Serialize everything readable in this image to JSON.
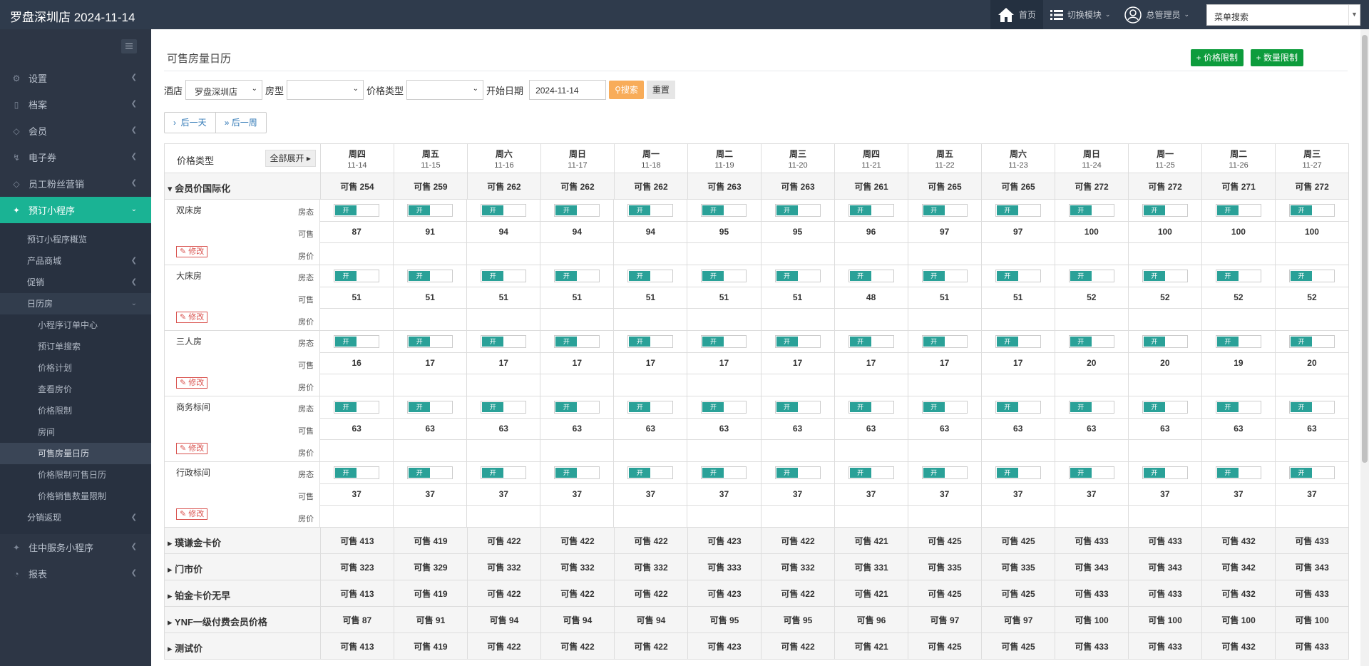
{
  "header": {
    "brand": "罗盘深圳店 2024-11-14",
    "home": "首页",
    "switch_module": "切换模块",
    "admin": "总管理员",
    "menu_search": "菜单搜索"
  },
  "sidebar": {
    "items": [
      {
        "label": "设置"
      },
      {
        "label": "档案"
      },
      {
        "label": "会员"
      },
      {
        "label": "电子券"
      },
      {
        "label": "员工粉丝营销"
      },
      {
        "label": "预订小程序"
      }
    ],
    "sub1": [
      "预订小程序概览",
      "产品商城",
      "促销",
      "日历房"
    ],
    "sub2": [
      "小程序订单中心",
      "预订单搜索",
      "价格计划",
      "查看房价",
      "价格限制",
      "房间",
      "可售房量日历",
      "价格限制可售日历",
      "价格销售数量限制"
    ],
    "sub_after": "分销返现",
    "items_after": [
      {
        "label": "住中服务小程序"
      },
      {
        "label": "报表"
      }
    ]
  },
  "page": {
    "title": "可售房量日历",
    "btn_price_limit": "+ 价格限制",
    "btn_qty_limit": "+ 数量限制"
  },
  "filters": {
    "hotel_label": "酒店",
    "hotel_value": "罗盘深圳店",
    "room_type_label": "房型",
    "price_type_label": "价格类型",
    "start_date_label": "开始日期",
    "start_date_value": "2024-11-14",
    "search": "搜索",
    "reset": "重置"
  },
  "pager": {
    "next_day": "后一天",
    "next_week": "后一周"
  },
  "grid": {
    "price_type_header": "价格类型",
    "expand_all": "全部展开",
    "days": [
      {
        "wd": "周四",
        "dt": "11-14"
      },
      {
        "wd": "周五",
        "dt": "11-15"
      },
      {
        "wd": "周六",
        "dt": "11-16"
      },
      {
        "wd": "周日",
        "dt": "11-17"
      },
      {
        "wd": "周一",
        "dt": "11-18"
      },
      {
        "wd": "周二",
        "dt": "11-19"
      },
      {
        "wd": "周三",
        "dt": "11-20"
      },
      {
        "wd": "周四",
        "dt": "11-21"
      },
      {
        "wd": "周五",
        "dt": "11-22"
      },
      {
        "wd": "周六",
        "dt": "11-23"
      },
      {
        "wd": "周日",
        "dt": "11-24"
      },
      {
        "wd": "周一",
        "dt": "11-25"
      },
      {
        "wd": "周二",
        "dt": "11-26"
      },
      {
        "wd": "周三",
        "dt": "11-27"
      }
    ],
    "row_labels": {
      "status": "房态",
      "avail": "可售",
      "price": "房价",
      "edit": "修改",
      "on": "开"
    },
    "groups": [
      {
        "name": "会员价国际化",
        "open": true,
        "values": [
          "可售 254",
          "可售 259",
          "可售 262",
          "可售 262",
          "可售 262",
          "可售 263",
          "可售 263",
          "可售 261",
          "可售 265",
          "可售 265",
          "可售 272",
          "可售 272",
          "可售 271",
          "可售 272"
        ],
        "rooms": [
          {
            "name": "双床房",
            "avail": [
              "87",
              "91",
              "94",
              "94",
              "94",
              "95",
              "95",
              "96",
              "97",
              "97",
              "100",
              "100",
              "100",
              "100"
            ]
          },
          {
            "name": "大床房",
            "avail": [
              "51",
              "51",
              "51",
              "51",
              "51",
              "51",
              "51",
              "48",
              "51",
              "51",
              "52",
              "52",
              "52",
              "52"
            ]
          },
          {
            "name": "三人房",
            "avail": [
              "16",
              "17",
              "17",
              "17",
              "17",
              "17",
              "17",
              "17",
              "17",
              "17",
              "20",
              "20",
              "19",
              "20"
            ]
          },
          {
            "name": "商务标间",
            "avail": [
              "63",
              "63",
              "63",
              "63",
              "63",
              "63",
              "63",
              "63",
              "63",
              "63",
              "63",
              "63",
              "63",
              "63"
            ]
          },
          {
            "name": "行政标间",
            "avail": [
              "37",
              "37",
              "37",
              "37",
              "37",
              "37",
              "37",
              "37",
              "37",
              "37",
              "37",
              "37",
              "37",
              "37"
            ]
          }
        ]
      },
      {
        "name": "璞谦金卡价",
        "open": false,
        "values": [
          "可售 413",
          "可售 419",
          "可售 422",
          "可售 422",
          "可售 422",
          "可售 423",
          "可售 422",
          "可售 421",
          "可售 425",
          "可售 425",
          "可售 433",
          "可售 433",
          "可售 432",
          "可售 433"
        ]
      },
      {
        "name": "门市价",
        "open": false,
        "values": [
          "可售 323",
          "可售 329",
          "可售 332",
          "可售 332",
          "可售 332",
          "可售 333",
          "可售 332",
          "可售 331",
          "可售 335",
          "可售 335",
          "可售 343",
          "可售 343",
          "可售 342",
          "可售 343"
        ]
      },
      {
        "name": "铂金卡价无早",
        "open": false,
        "values": [
          "可售 413",
          "可售 419",
          "可售 422",
          "可售 422",
          "可售 422",
          "可售 423",
          "可售 422",
          "可售 421",
          "可售 425",
          "可售 425",
          "可售 433",
          "可售 433",
          "可售 432",
          "可售 433"
        ]
      },
      {
        "name": "YNF一级付费会员价格",
        "open": false,
        "values": [
          "可售 87",
          "可售 91",
          "可售 94",
          "可售 94",
          "可售 94",
          "可售 95",
          "可售 95",
          "可售 96",
          "可售 97",
          "可售 97",
          "可售 100",
          "可售 100",
          "可售 100",
          "可售 100"
        ]
      },
      {
        "name": "测试价",
        "open": false,
        "values": [
          "可售 413",
          "可售 419",
          "可售 422",
          "可售 422",
          "可售 422",
          "可售 423",
          "可售 422",
          "可售 421",
          "可售 425",
          "可售 425",
          "可售 433",
          "可售 433",
          "可售 432",
          "可售 433"
        ]
      }
    ]
  },
  "colors": {
    "accent": "#1ab394",
    "topbar": "#2f3b4c",
    "sidebar": "#2d3645",
    "green_button": "#0d9c3c",
    "search_button": "#f8ac59",
    "toggle_on": "#2aa198"
  }
}
